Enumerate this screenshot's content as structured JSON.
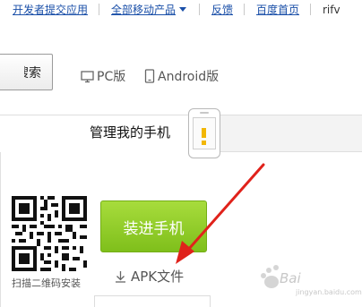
{
  "nav": {
    "links": [
      "开发者提交应用",
      "全部移动产品",
      "反馈",
      "百度首页",
      "rifv"
    ]
  },
  "search": {
    "button_label": "搜索",
    "visible_label": "搜索"
  },
  "platforms": {
    "pc": "PC版",
    "android": "Android版"
  },
  "tabs": {
    "active_label": "管理我的手机"
  },
  "install": {
    "qr_caption": "扫描二维码安装",
    "button_label": "装进手机",
    "apk_label": "APK文件"
  },
  "watermark": {
    "text": "Bai",
    "sub": "jingyan.baidu.com"
  },
  "colors": {
    "link": "#1a4fa8",
    "install_green": "#8fcb25",
    "arrow_red": "#e0221b",
    "warning_yellow": "#f2b705"
  },
  "icons": [
    "caret-down-icon",
    "monitor-icon",
    "mobile-icon",
    "download-icon",
    "warning-icon",
    "qr-code-icon"
  ]
}
